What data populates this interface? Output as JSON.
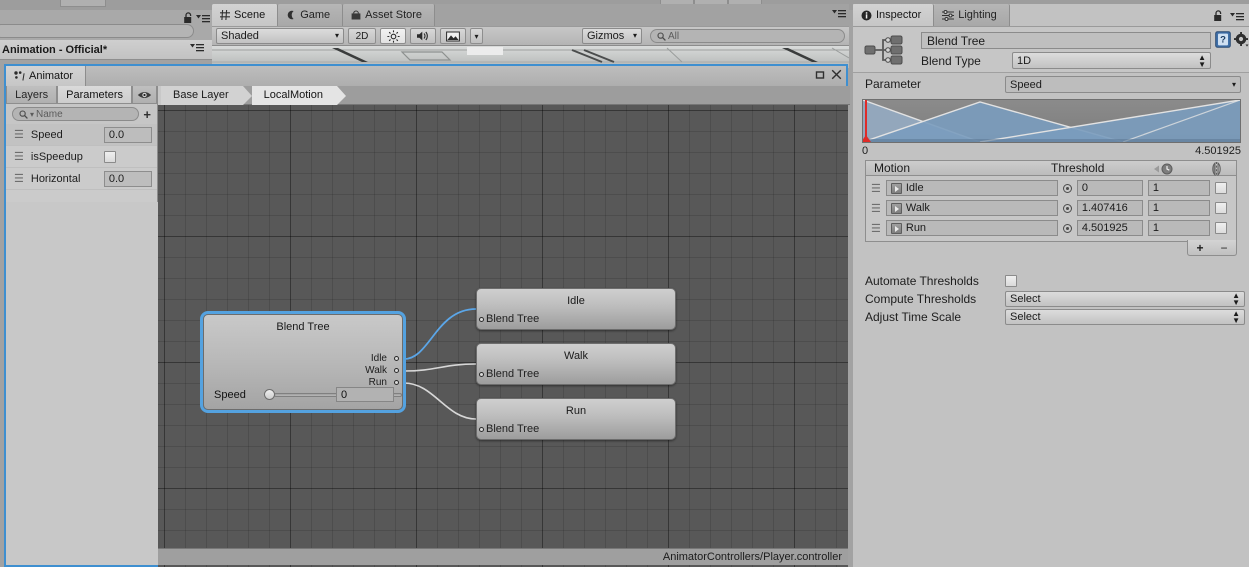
{
  "app": {
    "left_panel_title": "Animation - Official*",
    "left_search_placeholder": ""
  },
  "scene_panel": {
    "tabs": [
      {
        "label": "Scene",
        "icon": "grid-icon",
        "active": true
      },
      {
        "label": "Game",
        "icon": "moon-icon",
        "active": false
      },
      {
        "label": "Asset Store",
        "icon": "store-icon",
        "active": false
      }
    ],
    "toolbar": {
      "draw_mode": "Shaded",
      "two_d_label": "2D",
      "lighting_icon": "sun-icon",
      "audio_icon": "speaker-icon",
      "effects_icon": "image-icon",
      "gizmos_label": "Gizmos",
      "search_placeholder": "All"
    }
  },
  "animator": {
    "tab_label": "Animator",
    "tab_icon": "animator-icon",
    "sub_tabs": [
      {
        "label": "Layers",
        "active": false
      },
      {
        "label": "Parameters",
        "active": true
      }
    ],
    "eye_icon": "eye-icon",
    "search_placeholder": "Name",
    "add_label": "+",
    "parameters": [
      {
        "name": "Speed",
        "type": "float",
        "value": "0.0"
      },
      {
        "name": "isSpeedup",
        "type": "bool",
        "value": ""
      },
      {
        "name": "Horizontal",
        "type": "float",
        "value": "0.0"
      }
    ],
    "breadcrumb": [
      "Base Layer",
      "LocalMotion"
    ],
    "status_text": "AnimatorControllers/Player.controller",
    "graph": {
      "blend_tree_node": {
        "title": "Blend Tree",
        "ports": [
          "Idle",
          "Walk",
          "Run"
        ],
        "slider_label": "Speed",
        "slider_value": "0",
        "slider_position_pct": 0
      },
      "motion_nodes": [
        {
          "title": "Idle",
          "subtitle": "Blend Tree",
          "highlighted": true
        },
        {
          "title": "Walk",
          "subtitle": "Blend Tree",
          "highlighted": false
        },
        {
          "title": "Run",
          "subtitle": "Blend Tree",
          "highlighted": false
        }
      ]
    }
  },
  "inspector": {
    "tabs": [
      {
        "label": "Inspector",
        "icon": "info-icon",
        "active": true
      },
      {
        "label": "Lighting",
        "icon": "lighting-icon",
        "active": false
      }
    ],
    "lock_icon": "lock-icon",
    "menu_icon": "menu-icon",
    "asset_name": "Blend Tree",
    "help_icon": "help-icon",
    "gear_icon": "gear-icon",
    "blend_type_label": "Blend Type",
    "blend_type_value": "1D",
    "parameter_label": "Parameter",
    "parameter_value": "Speed",
    "axis_min": "0",
    "axis_max": "4.501925",
    "table": {
      "columns": [
        "Motion",
        "Threshold",
        "",
        ""
      ],
      "time_scale_icon": "clock-icon",
      "mirror_icon": "mirror-icon",
      "rows": [
        {
          "motion": "Idle",
          "threshold": "0",
          "time_scale": "1",
          "mirror": false
        },
        {
          "motion": "Walk",
          "threshold": "1.407416",
          "time_scale": "1",
          "mirror": false
        },
        {
          "motion": "Run",
          "threshold": "4.501925",
          "time_scale": "1",
          "mirror": false
        }
      ],
      "add_label": "+",
      "remove_label": "−"
    },
    "settings": [
      {
        "label": "Automate Thresholds",
        "type": "checkbox",
        "value": ""
      },
      {
        "label": "Compute Thresholds",
        "type": "popup",
        "value": "Select"
      },
      {
        "label": "Adjust Time Scale",
        "type": "popup",
        "value": "Select"
      }
    ]
  },
  "colors": {
    "accent_blue": "#3e8fd0",
    "graph_bg": "#585858",
    "panel_bg": "#c2c2c2",
    "blend_fill": "#7b9bbd",
    "playhead_red": "#e02b28"
  }
}
